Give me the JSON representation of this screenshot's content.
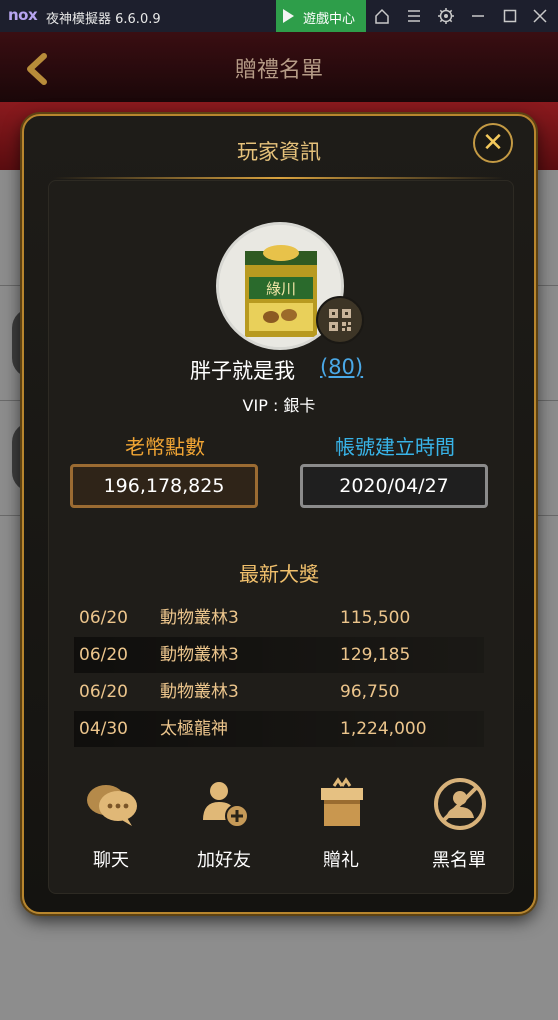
{
  "emulator": {
    "logo": "nox",
    "title": "夜神模擬器 6.6.0.9",
    "game_center_label": "遊戲中心",
    "controls": [
      "home-icon",
      "menu-icon",
      "settings-icon",
      "minimize-icon",
      "maximize-icon",
      "close-icon"
    ]
  },
  "header": {
    "title": "贈禮名單"
  },
  "dialog": {
    "title": "玩家資訊",
    "close_label": "✕",
    "player": {
      "avatar_text": "綠川",
      "name": "胖子就是我",
      "level": "(80)",
      "vip": "VIP : 銀卡"
    },
    "stats": {
      "coins_label": "老幣點數",
      "coins_value": "196,178,825",
      "created_label": "帳號建立時間",
      "created_value": "2020/04/27"
    },
    "jackpots": {
      "title": "最新大獎",
      "rows": [
        {
          "date": "06/20",
          "game": "動物叢林3",
          "amount": "115,500"
        },
        {
          "date": "06/20",
          "game": "動物叢林3",
          "amount": "129,185"
        },
        {
          "date": "06/20",
          "game": "動物叢林3",
          "amount": "96,750"
        },
        {
          "date": "04/30",
          "game": "太極龍神",
          "amount": "1,224,000"
        }
      ]
    },
    "actions": [
      {
        "label": "聊天",
        "icon": "chat-bubbles-icon"
      },
      {
        "label": "加好友",
        "icon": "add-friend-icon"
      },
      {
        "label": "贈礼",
        "icon": "gift-box-icon"
      },
      {
        "label": "黑名單",
        "icon": "blacklist-icon"
      }
    ]
  },
  "colors": {
    "accent_gold": "#e6c27b",
    "coin_orange": "#f1a534",
    "date_blue": "#38b4e8",
    "level_link": "#4aa8e6",
    "gamecenter_green": "#2e9e4a"
  }
}
